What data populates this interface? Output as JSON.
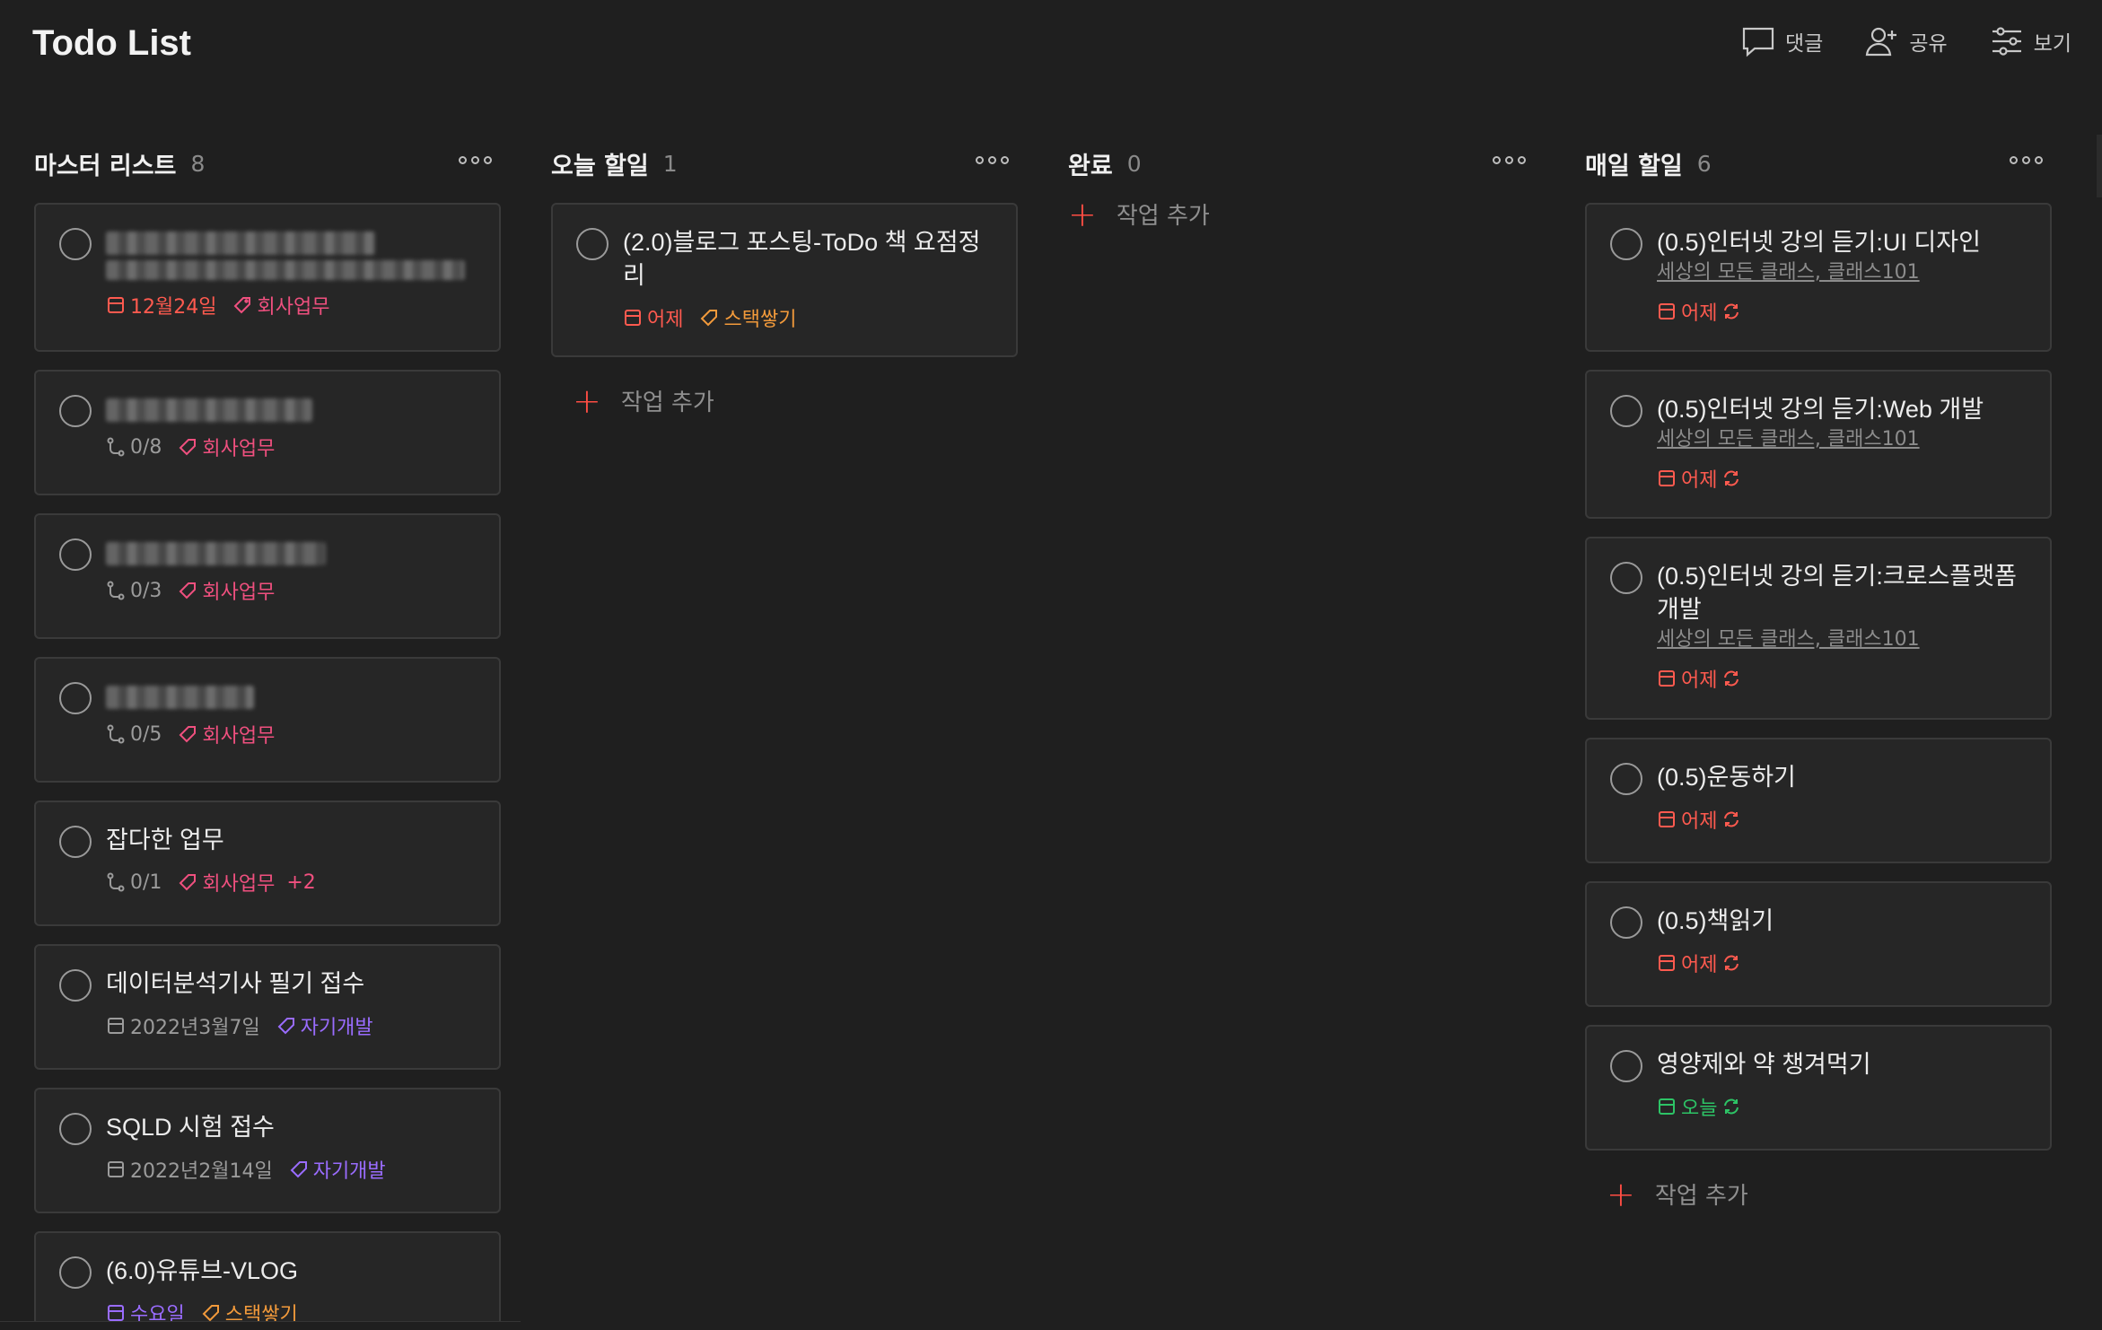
{
  "app": {
    "title": "Todo List"
  },
  "header_actions": {
    "comment": "댓글",
    "share": "공유",
    "view": "보기"
  },
  "columns": [
    {
      "title": "마스터 리스트",
      "count": "8",
      "cards": [
        {
          "title": "",
          "blurred": true,
          "date": "12월24일",
          "tag": "회사업무"
        },
        {
          "title": "",
          "blurred": true,
          "subtasks": "0/8",
          "tag": "회사업무"
        },
        {
          "title": "",
          "blurred": true,
          "subtasks": "0/3",
          "tag": "회사업무"
        },
        {
          "title": "",
          "blurred": true,
          "subtasks": "0/5",
          "tag": "회사업무"
        },
        {
          "title": "잡다한 업무",
          "subtasks": "0/1",
          "tag": "회사업무",
          "extra": "+2"
        },
        {
          "title": "데이터분석기사 필기 접수",
          "date": "2022년3월7일",
          "tag": "자기개발"
        },
        {
          "title": "SQLD 시험 접수",
          "date": "2022년2월14일",
          "tag": "자기개발"
        },
        {
          "title": "(6.0)유튜브-VLOG",
          "date": "수요일",
          "tag": "스택쌓기"
        }
      ]
    },
    {
      "title": "오늘 할일",
      "count": "1",
      "cards": [
        {
          "title": "(2.0)블로그 포스팅-ToDo 책 요점정리",
          "date": "어제",
          "tag": "스택쌓기"
        }
      ],
      "add_label": "작업 추가"
    },
    {
      "title": "완료",
      "count": "0",
      "add_label": "작업 추가"
    },
    {
      "title": "매일 할일",
      "count": "6",
      "cards": [
        {
          "title": "(0.5)인터넷 강의 듣기:UI 디자인",
          "subtitle": "세상의 모든 클래스, 클래스101",
          "date": "어제"
        },
        {
          "title": "(0.5)인터넷 강의 듣기:Web 개발",
          "subtitle": "세상의 모든 클래스, 클래스101",
          "date": "어제"
        },
        {
          "title": "(0.5)인터넷 강의 듣기:크로스플랫폼 개발",
          "subtitle": "세상의 모든 클래스, 클래스101",
          "date": "어제"
        },
        {
          "title": "(0.5)운동하기",
          "date": "어제"
        },
        {
          "title": "(0.5)책읽기",
          "date": "어제"
        },
        {
          "title": "영양제와 약 챙겨먹기",
          "date": "오늘"
        }
      ],
      "add_label": "작업 추가"
    }
  ],
  "colors": {
    "background": "#1f1f1f",
    "card": "#262626",
    "overdue_red": "#ff5a4f",
    "tag_pink": "#f0507f",
    "tag_orange": "#f29a3b",
    "tag_purple": "#9a6cff",
    "today_green": "#2dc466",
    "accent_plus": "#ff4d43"
  }
}
